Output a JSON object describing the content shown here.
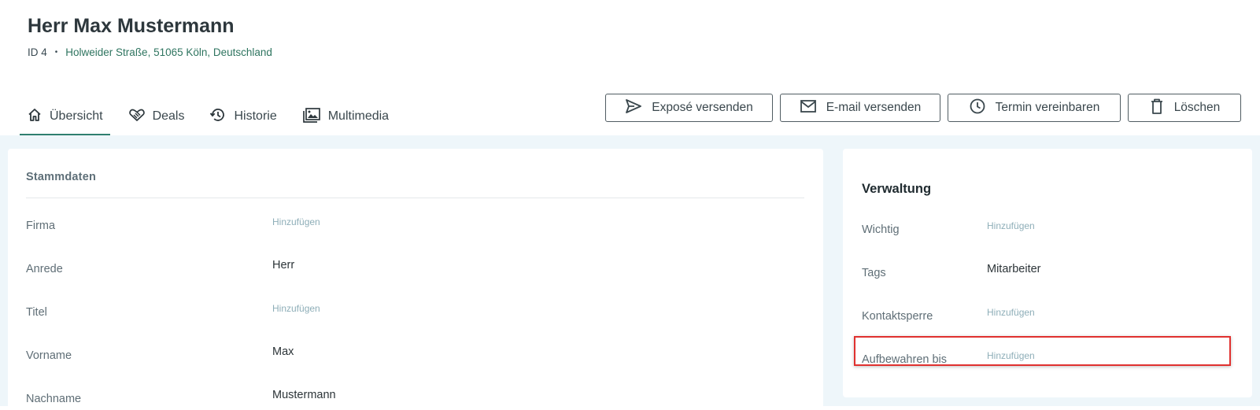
{
  "contact": {
    "name": "Herr Max Mustermann",
    "id_label": "ID 4",
    "separator": "•",
    "address": "Holweider Straße, 51065 Köln, Deutschland"
  },
  "tabs": [
    {
      "label": "Übersicht",
      "icon": "home-icon",
      "active": true
    },
    {
      "label": "Deals",
      "icon": "handshake-icon",
      "active": false
    },
    {
      "label": "Historie",
      "icon": "history-icon",
      "active": false
    },
    {
      "label": "Multimedia",
      "icon": "images-icon",
      "active": false
    }
  ],
  "actions": [
    {
      "label": "Exposé versenden",
      "icon": "send-icon"
    },
    {
      "label": "E-mail versenden",
      "icon": "mail-icon"
    },
    {
      "label": "Termin vereinbaren",
      "icon": "clock-icon"
    },
    {
      "label": "Löschen",
      "icon": "trash-icon"
    }
  ],
  "stammdaten": {
    "title": "Stammdaten",
    "rows": [
      {
        "label": "Firma",
        "value": "Hinzufügen",
        "empty": true
      },
      {
        "label": "Anrede",
        "value": "Herr",
        "empty": false
      },
      {
        "label": "Titel",
        "value": "Hinzufügen",
        "empty": true
      },
      {
        "label": "Vorname",
        "value": "Max",
        "empty": false
      },
      {
        "label": "Nachname",
        "value": "Mustermann",
        "empty": false
      }
    ]
  },
  "verwaltung": {
    "title": "Verwaltung",
    "rows": [
      {
        "label": "Wichtig",
        "value": "Hinzufügen",
        "empty": true
      },
      {
        "label": "Tags",
        "value": "Mitarbeiter",
        "empty": false
      },
      {
        "label": "Kontaktsperre",
        "value": "Hinzufügen",
        "empty": true
      },
      {
        "label": "Aufbewahren bis",
        "value": "Hinzufügen",
        "empty": true
      }
    ]
  },
  "colors": {
    "accent": "#2f7f6f",
    "address": "#2f7560",
    "background": "#eef6fa",
    "placeholder": "#8eaeb8",
    "highlight": "#e0312f"
  }
}
